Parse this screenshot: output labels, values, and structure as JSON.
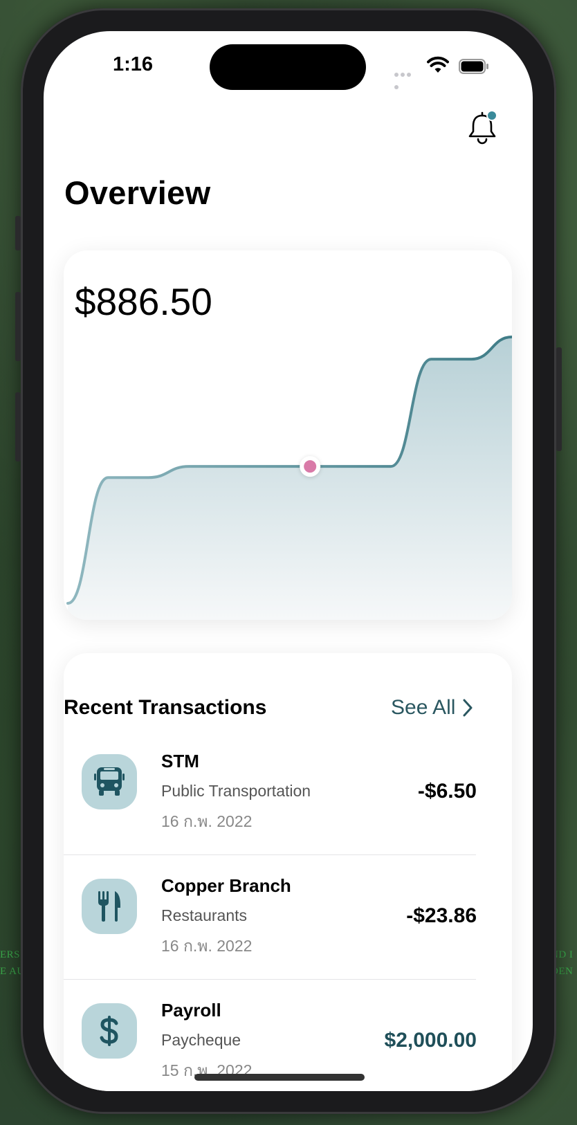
{
  "status_bar": {
    "time": "1:16"
  },
  "header": {
    "title": "Overview",
    "notification_icon": "bell-icon",
    "has_unread": true
  },
  "balance": {
    "amount": "$886.50"
  },
  "chart_data": {
    "type": "area",
    "series": [
      {
        "values": [
          0,
          34,
          34,
          37,
          37,
          37,
          37,
          37,
          37,
          66,
          66,
          72
        ]
      }
    ],
    "highlighted_index": 6,
    "colors": {
      "line": "#4f8a94",
      "fill_top": "#b7d0d6",
      "fill_bottom": "#f6f8f9",
      "highlight": "#d97aa8"
    }
  },
  "transactions": {
    "title": "Recent Transactions",
    "see_all_label": "See All",
    "items": [
      {
        "name": "STM",
        "category": "Public Transportation",
        "date": "16 ก.พ. 2022",
        "amount": "-$6.50",
        "icon": "bus-icon",
        "positive": false
      },
      {
        "name": "Copper Branch",
        "category": "Restaurants",
        "date": "16 ก.พ. 2022",
        "amount": "-$23.86",
        "icon": "fork-knife-icon",
        "positive": false
      },
      {
        "name": "Payroll",
        "category": "Paycheque",
        "date": "15 ก.พ. 2022",
        "amount": "$2,000.00",
        "icon": "dollar-icon",
        "positive": true
      }
    ]
  },
  "colors": {
    "accent": "#2a5760",
    "icon_bg": "#b9d5da",
    "badge": "#3a8a9a"
  }
}
